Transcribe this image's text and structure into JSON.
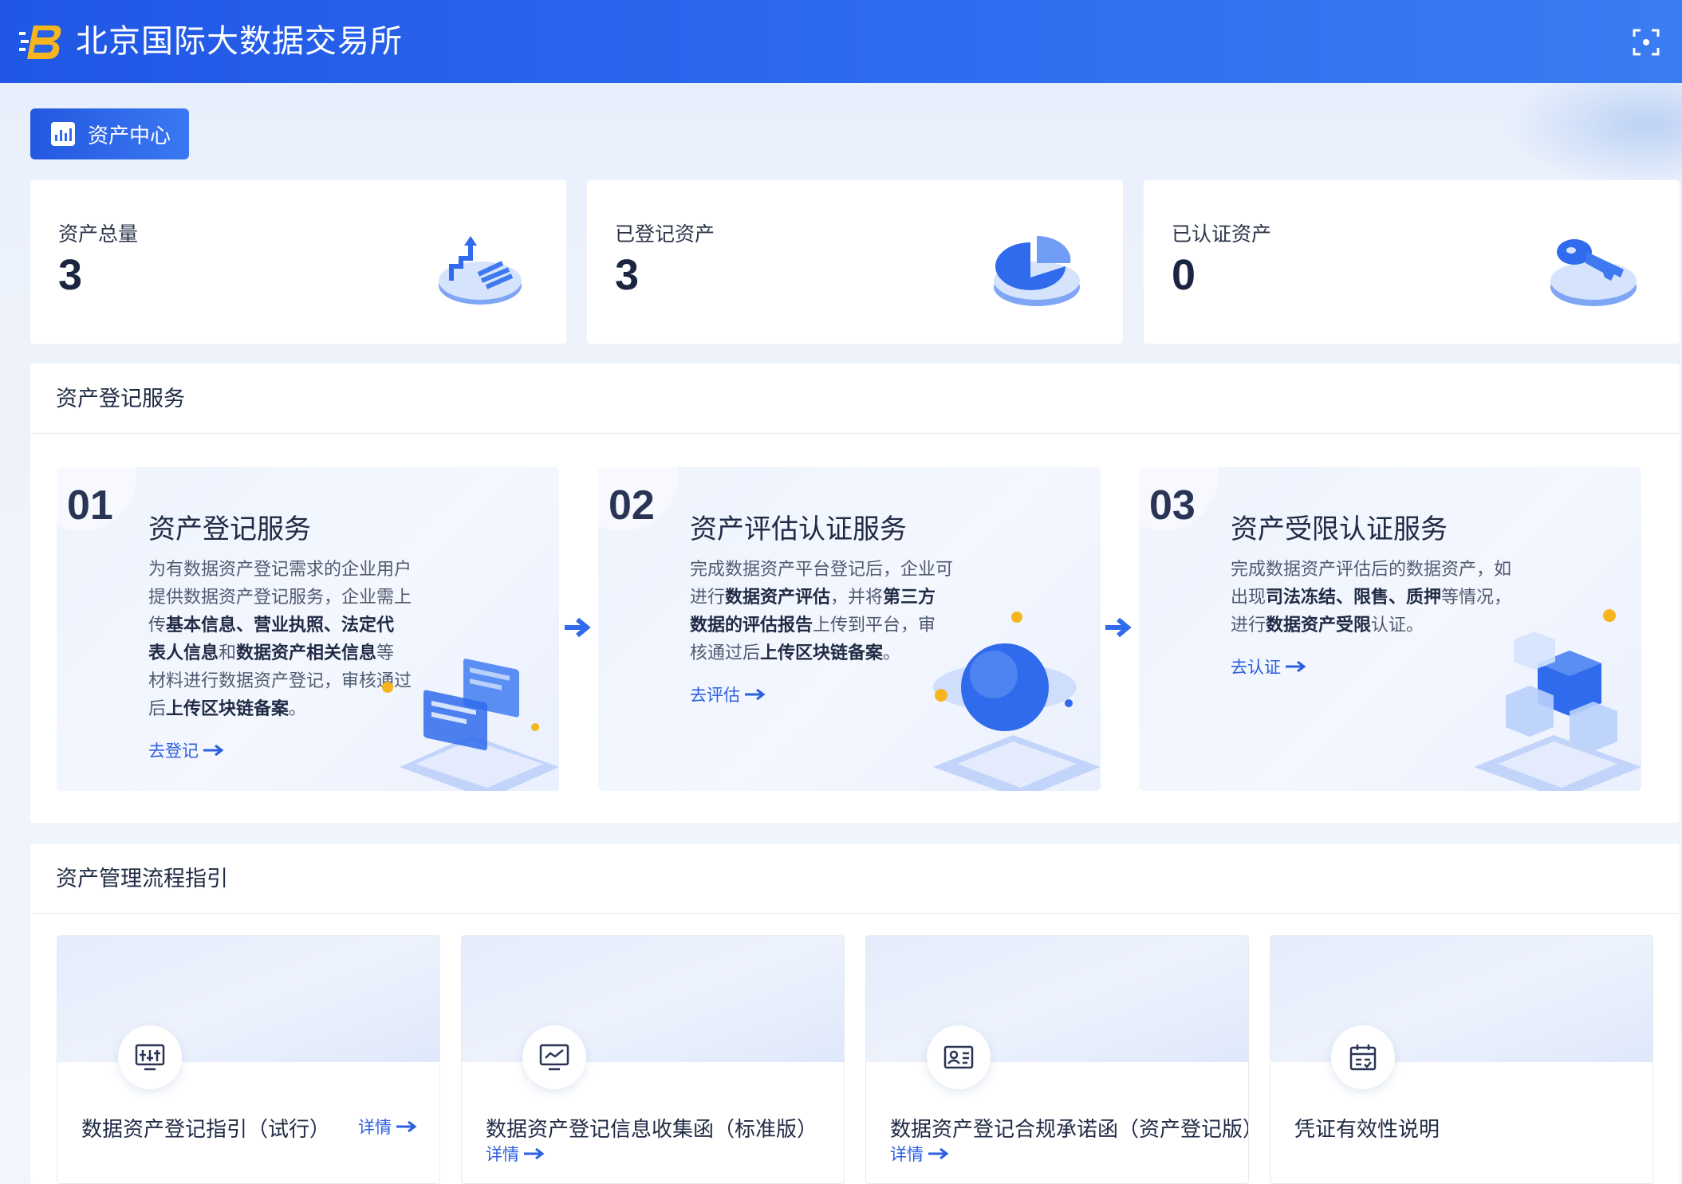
{
  "header": {
    "title": "北京国际大数据交易所",
    "logo_icon": "bjidex-logo-icon",
    "fullscreen_icon": "fullscreen-icon"
  },
  "tab": {
    "label": "资产中心",
    "icon": "bar-chart-icon"
  },
  "stats": [
    {
      "label": "资产总量",
      "value": "3",
      "icon": "stairs-up-icon"
    },
    {
      "label": "已登记资产",
      "value": "3",
      "icon": "pie-chart-icon"
    },
    {
      "label": "已认证资产",
      "value": "0",
      "icon": "key-icon"
    }
  ],
  "register_section": {
    "title": "资产登记服务",
    "services": [
      {
        "num": "01",
        "title": "资产登记服务",
        "desc": [
          {
            "t": "为有数据资产登记需求的企业用户提供数据资产登记服务，企业需上传",
            "b": false
          },
          {
            "t": "基本信息、营业执照、法定代表人信息",
            "b": true
          },
          {
            "t": "和",
            "b": false
          },
          {
            "t": "数据资产相关信息",
            "b": true
          },
          {
            "t": "等材料进行数据资产登记，审核通过后",
            "b": false
          },
          {
            "t": "上传区块链备案",
            "b": true
          },
          {
            "t": "。",
            "b": false
          }
        ],
        "link": "去登记"
      },
      {
        "num": "02",
        "title": "资产评估认证服务",
        "desc": [
          {
            "t": "完成数据资产平台登记后，企业可进行",
            "b": false
          },
          {
            "t": "数据资产评估",
            "b": true
          },
          {
            "t": "，并将",
            "b": false
          },
          {
            "t": "第三方数据的评估报告",
            "b": true
          },
          {
            "t": "上传到平台，审核通过后",
            "b": false
          },
          {
            "t": "上传区块链备案",
            "b": true
          },
          {
            "t": "。",
            "b": false
          }
        ],
        "link": "去评估"
      },
      {
        "num": "03",
        "title": "资产受限认证服务",
        "desc": [
          {
            "t": "完成数据资产评估后的数据资产，如出现",
            "b": false
          },
          {
            "t": "司法冻结、限售、质押",
            "b": true
          },
          {
            "t": "等情况，进行",
            "b": false
          },
          {
            "t": "数据资产受限",
            "b": true
          },
          {
            "t": "认证。",
            "b": false
          }
        ],
        "link": "去认证"
      }
    ]
  },
  "guide_section": {
    "title": "资产管理流程指引",
    "items": [
      {
        "title": "数据资产登记指引（试行）",
        "link": "详情",
        "icon": "equalizer-icon"
      },
      {
        "title": "数据资产登记信息收集函（标准版）",
        "link": "详情",
        "icon": "monitor-icon"
      },
      {
        "title": "数据资产登记合规承诺函（资产登记版）",
        "link": "详情",
        "icon": "id-card-icon"
      },
      {
        "title": "凭证有效性说明",
        "link": "",
        "icon": "calendar-icon"
      }
    ]
  },
  "colors": {
    "primary": "#2f6bec",
    "header_start": "#2057e6",
    "link": "#2c5fe0"
  }
}
